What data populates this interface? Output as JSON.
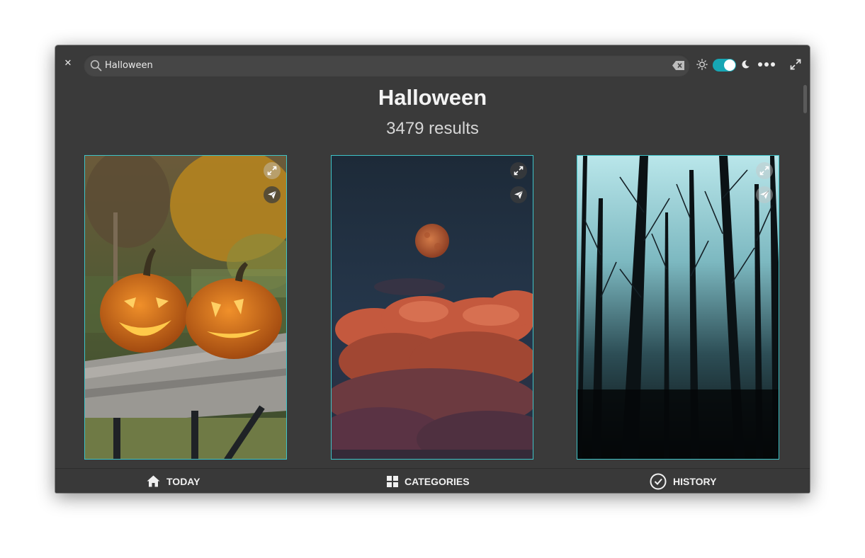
{
  "search": {
    "value": "Halloween"
  },
  "header": {
    "title": "Halloween",
    "results": "3479 results"
  },
  "toggle": {
    "dark_mode": true,
    "accent": "#17a6b4"
  },
  "cards": [
    {
      "subject": "jack-o-lanterns-on-table"
    },
    {
      "subject": "moon-over-red-clouds"
    },
    {
      "subject": "foggy-bare-forest"
    }
  ],
  "nav": {
    "today_label": "TODAY",
    "categories_label": "CATEGORIES",
    "history_label": "HISTORY"
  },
  "colors": {
    "window_bg": "#3a3a3a",
    "card_border": "#3ec4c8"
  }
}
